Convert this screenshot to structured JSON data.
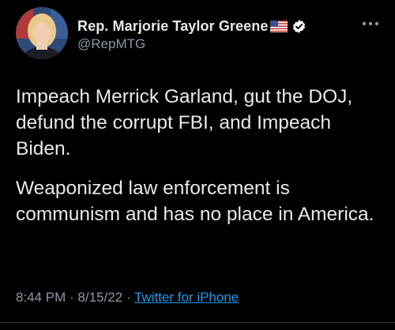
{
  "author": {
    "display_name": "Rep. Marjorie Taylor Greene",
    "handle": "@RepMTG",
    "flag_icon": "us-flag-icon",
    "verified_icon": "verified-badge-icon"
  },
  "tweet": {
    "paragraphs": [
      "Impeach Merrick Garland, gut the DOJ, defund the corrupt FBI, and Impeach Biden.",
      "Weaponized law enforcement is communism and has no place in America."
    ]
  },
  "meta": {
    "time": "8:44 PM",
    "separator_1": " · ",
    "date": "8/15/22",
    "separator_2": " · ",
    "source": "Twitter for iPhone"
  },
  "menu": {
    "icon": "more-horizontal-icon"
  },
  "colors": {
    "background": "#000000",
    "text": "#e7e9ea",
    "secondary_text": "#8b98a5",
    "link": "#1d9bf0",
    "verified_badge": "#ffffff"
  }
}
